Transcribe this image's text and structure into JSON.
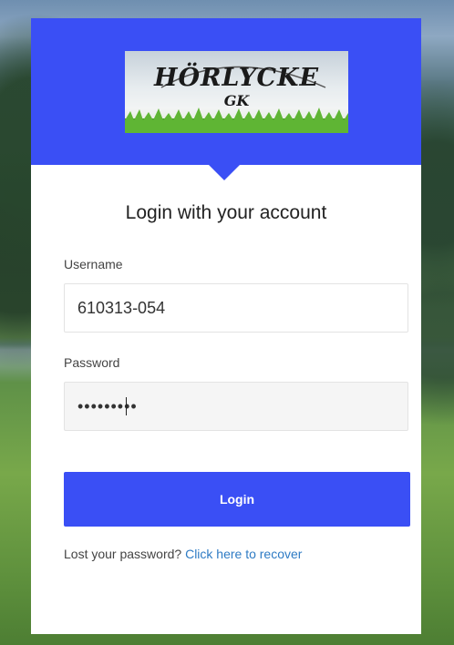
{
  "logo": {
    "name": "HÖRLYCKE",
    "sub": "GK"
  },
  "login_form": {
    "title": "Login with your account",
    "username_label": "Username",
    "username_value": "610313-054",
    "password_label": "Password",
    "password_value": "•••••••••",
    "login_button": "Login",
    "recover_prompt": "Lost your password?",
    "recover_link": "Click here to recover"
  },
  "colors": {
    "primary": "#3a4ff5",
    "link": "#2e7bc4"
  }
}
